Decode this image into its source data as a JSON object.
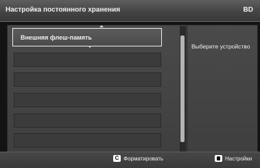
{
  "header": {
    "title": "Настройка постоянного хранения",
    "source_label": "BD"
  },
  "device_list": {
    "items": [
      {
        "label": "Внешняя флеш-память",
        "selected": true
      },
      {
        "label": "",
        "selected": false
      },
      {
        "label": "",
        "selected": false
      },
      {
        "label": "",
        "selected": false
      },
      {
        "label": "",
        "selected": false
      },
      {
        "label": "",
        "selected": false
      },
      {
        "label": "",
        "selected": false
      }
    ]
  },
  "info_panel": {
    "hint": "Выберите устройство"
  },
  "footer": {
    "format": {
      "key_label": "C",
      "label": "Форматировать",
      "icon": "c-key-icon"
    },
    "settings": {
      "label": "Настройки",
      "icon": "settings-key-icon"
    }
  }
}
